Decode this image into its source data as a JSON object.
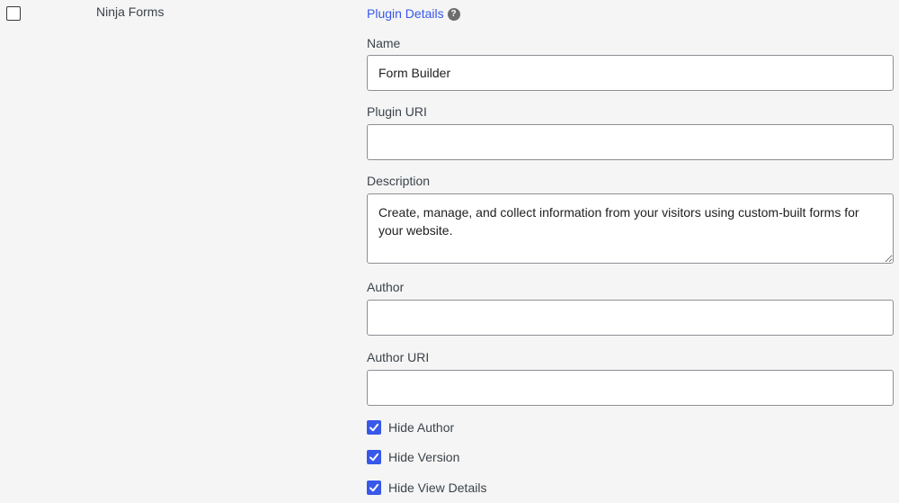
{
  "plugin_row": {
    "name": "Ninja Forms",
    "selected": false
  },
  "details": {
    "title": "Plugin Details",
    "help_icon": "question-circle-icon",
    "fields": {
      "name": {
        "label": "Name",
        "value": "Form Builder"
      },
      "plugin_uri": {
        "label": "Plugin URI",
        "value": ""
      },
      "description": {
        "label": "Description",
        "value": "Create, manage, and collect information from your visitors using custom-built forms for your website."
      },
      "author": {
        "label": "Author",
        "value": ""
      },
      "author_uri": {
        "label": "Author URI",
        "value": ""
      }
    },
    "options": [
      {
        "label": "Hide Author",
        "checked": true
      },
      {
        "label": "Hide Version",
        "checked": true
      },
      {
        "label": "Hide View Details",
        "checked": true
      }
    ]
  },
  "colors": {
    "accent": "#3858e9",
    "background": "#f5f5f5",
    "text": "#3c434a",
    "border": "#8c8f94"
  }
}
